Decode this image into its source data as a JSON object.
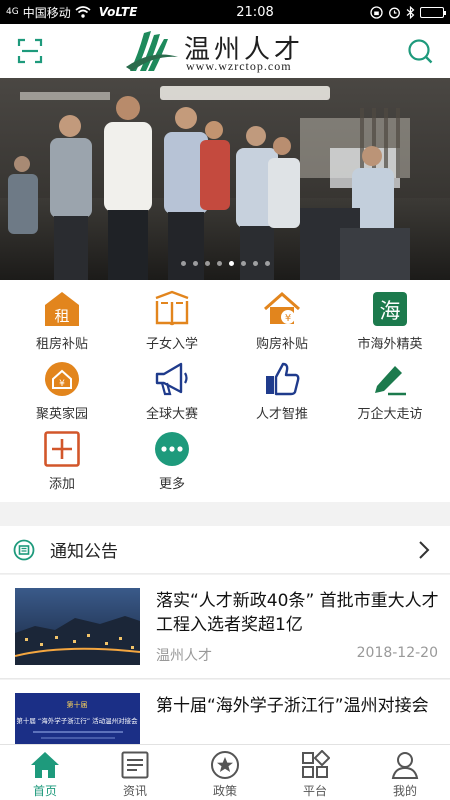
{
  "status_bar": {
    "signal": "4G",
    "carrier": "中国移动",
    "volte": "VoLTE",
    "time": "21:08"
  },
  "header": {
    "logo_title": "温州人才",
    "logo_url": "www.wzrctop.com",
    "scan_icon": "scan-icon",
    "search_icon": "search-icon",
    "brand_color": "#1e8a5c"
  },
  "banner": {
    "slide_count": 8,
    "active_slide": 5
  },
  "menu": [
    {
      "label": "租房补贴",
      "icon": "rent-subsidy-icon",
      "glyph": "租"
    },
    {
      "label": "子女入学",
      "icon": "book-icon"
    },
    {
      "label": "购房补贴",
      "icon": "house-yuan-icon"
    },
    {
      "label": "市海外精英",
      "icon": "overseas-elite-icon",
      "glyph": "海"
    },
    {
      "label": "聚英家园",
      "icon": "home-yuan-icon"
    },
    {
      "label": "全球大赛",
      "icon": "megaphone-icon"
    },
    {
      "label": "人才智推",
      "icon": "thumbs-up-icon"
    },
    {
      "label": "万企大走访",
      "icon": "pen-icon"
    },
    {
      "label": "添加",
      "icon": "add-icon"
    },
    {
      "label": "更多",
      "icon": "more-icon"
    }
  ],
  "notice": {
    "title": "通知公告"
  },
  "news": [
    {
      "title": "落实“人才新政40条” 首批市重大人才工程入选者奖超1亿",
      "source": "温州人才",
      "date": "2018-12-20"
    },
    {
      "title": "第十届“海外学子浙江行”温州对接会",
      "thumb_text": "第十届 “海外学子浙江行” 活动温州对接会"
    }
  ],
  "tabs": [
    {
      "label": "首页",
      "icon": "home-icon",
      "active": true
    },
    {
      "label": "资讯",
      "icon": "news-icon",
      "active": false
    },
    {
      "label": "政策",
      "icon": "policy-star-icon",
      "active": false
    },
    {
      "label": "平台",
      "icon": "platform-grid-icon",
      "active": false
    },
    {
      "label": "我的",
      "icon": "profile-icon",
      "active": false
    }
  ],
  "colors": {
    "accent": "#1e9a7c",
    "orange": "#e2851d",
    "navy": "#1f3b8c",
    "green_dark": "#1c7a4d",
    "red_outline": "#d2562a"
  }
}
